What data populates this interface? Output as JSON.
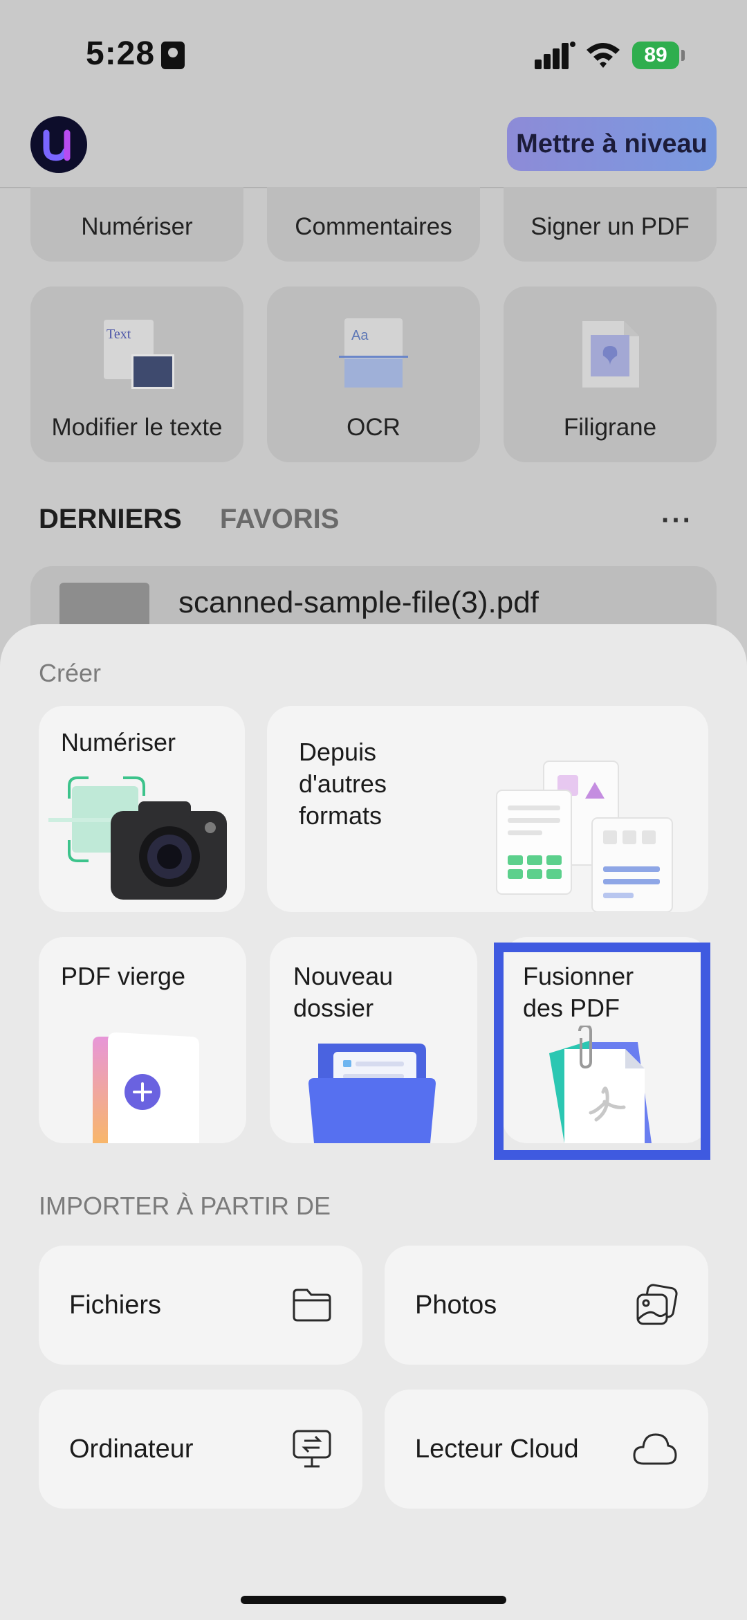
{
  "status_bar": {
    "time": "5:28",
    "battery": "89"
  },
  "header": {
    "upgrade_label": "Mettre à niveau"
  },
  "tools": {
    "row1": [
      "Numériser",
      "Commentaires",
      "Signer un PDF"
    ],
    "row2": [
      {
        "label": "Modifier le texte",
        "icon": "edit-text-icon",
        "icon_text": "Text"
      },
      {
        "label": "OCR",
        "icon": "ocr-icon",
        "icon_text": "Aa"
      },
      {
        "label": "Filigrane",
        "icon": "watermark-icon"
      }
    ]
  },
  "file_tabs": {
    "recent": "DERNIERS",
    "favorites": "FAVORIS",
    "more": "···"
  },
  "recent_file": {
    "name": "scanned-sample-file(3).pdf"
  },
  "sheet": {
    "create_heading": "Créer",
    "create": {
      "scan": "Numériser",
      "other_formats": "Depuis d'autres formats",
      "blank_pdf": "PDF vierge",
      "new_folder": "Nouveau dossier",
      "merge_pdf": "Fusionner des PDF"
    },
    "import_heading": "IMPORTER À PARTIR DE",
    "import": [
      {
        "label": "Fichiers",
        "icon": "folder-icon"
      },
      {
        "label": "Photos",
        "icon": "photos-icon"
      },
      {
        "label": "Ordinateur",
        "icon": "computer-transfer-icon"
      },
      {
        "label": "Lecteur Cloud",
        "icon": "cloud-icon"
      }
    ]
  },
  "colors": {
    "accent": "#3f5ae0",
    "battery": "#2fae4e",
    "highlight_border": "#3f5ae0"
  }
}
